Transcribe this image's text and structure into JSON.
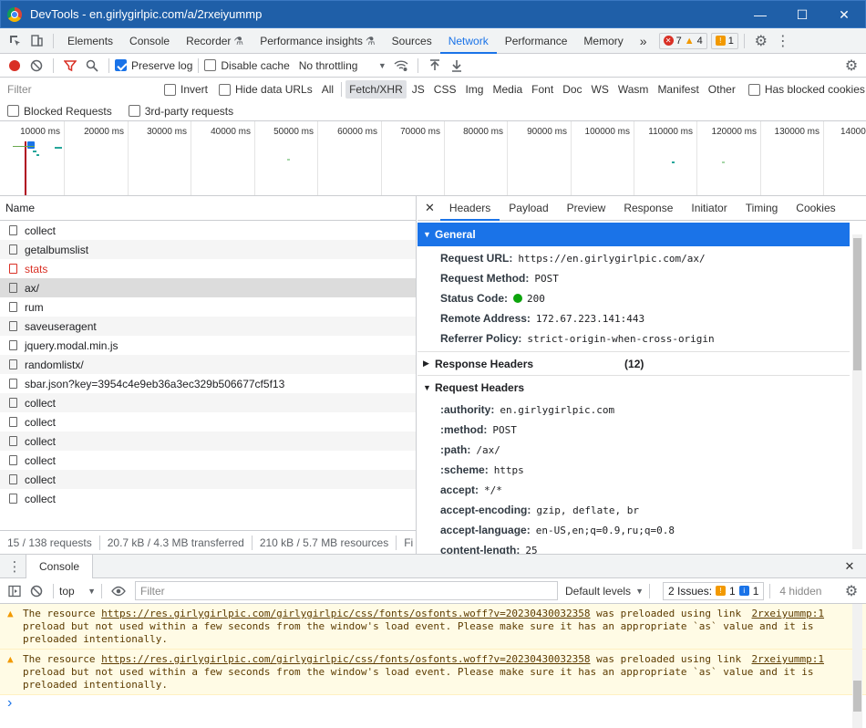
{
  "window": {
    "title": "DevTools - en.girlygirlpic.com/a/2rxeiyummp",
    "minimize": "—",
    "maximize": "☐",
    "close": "✕"
  },
  "main_tabs": {
    "items": [
      "Elements",
      "Console",
      "Recorder",
      "Performance insights",
      "Sources",
      "Network",
      "Performance",
      "Memory"
    ],
    "active": "Network",
    "more": "»",
    "errors": "7",
    "warnings": "4",
    "issues": "1"
  },
  "network_toolbar": {
    "preserve_log": "Preserve log",
    "disable_cache": "Disable cache",
    "throttling": "No throttling"
  },
  "filter": {
    "placeholder": "Filter",
    "invert": "Invert",
    "hide_data_urls": "Hide data URLs",
    "types": [
      "All",
      "Fetch/XHR",
      "JS",
      "CSS",
      "Img",
      "Media",
      "Font",
      "Doc",
      "WS",
      "Wasm",
      "Manifest",
      "Other"
    ],
    "active_type": "Fetch/XHR",
    "has_blocked_cookies": "Has blocked cookies",
    "blocked_requests": "Blocked Requests",
    "third_party": "3rd-party requests"
  },
  "overview": {
    "ticks": [
      "10000 ms",
      "20000 ms",
      "30000 ms",
      "40000 ms",
      "50000 ms",
      "60000 ms",
      "70000 ms",
      "80000 ms",
      "90000 ms",
      "100000 ms",
      "110000 ms",
      "120000 ms",
      "130000 ms",
      "14000"
    ]
  },
  "requests": {
    "column_name": "Name",
    "rows": [
      {
        "name": "collect",
        "status": "ok"
      },
      {
        "name": "getalbumslist",
        "status": "ok"
      },
      {
        "name": "stats",
        "status": "failed"
      },
      {
        "name": "ax/",
        "status": "selected"
      },
      {
        "name": "rum",
        "status": "ok"
      },
      {
        "name": "saveuseragent",
        "status": "ok"
      },
      {
        "name": "jquery.modal.min.js",
        "status": "ok"
      },
      {
        "name": "randomlistx/",
        "status": "ok"
      },
      {
        "name": "sbar.json?key=3954c4e9eb36a3ec329b506677cf5f13",
        "status": "ok"
      },
      {
        "name": "collect",
        "status": "ok"
      },
      {
        "name": "collect",
        "status": "ok"
      },
      {
        "name": "collect",
        "status": "ok"
      },
      {
        "name": "collect",
        "status": "ok"
      },
      {
        "name": "collect",
        "status": "ok"
      },
      {
        "name": "collect",
        "status": "ok"
      }
    ],
    "status": {
      "count": "15 / 138 requests",
      "transferred": "20.7 kB / 4.3 MB transferred",
      "resources": "210 kB / 5.7 MB resources",
      "finish": "Fi"
    }
  },
  "details": {
    "close": "✕",
    "tabs": [
      "Headers",
      "Payload",
      "Preview",
      "Response",
      "Initiator",
      "Timing",
      "Cookies"
    ],
    "active_tab": "Headers",
    "general": {
      "title": "General",
      "rows": [
        {
          "k": "Request URL:",
          "v": "https://en.girlygirlpic.com/ax/"
        },
        {
          "k": "Request Method:",
          "v": "POST"
        },
        {
          "k": "Status Code:",
          "v": "200"
        },
        {
          "k": "Remote Address:",
          "v": "172.67.223.141:443"
        },
        {
          "k": "Referrer Policy:",
          "v": "strict-origin-when-cross-origin"
        }
      ]
    },
    "response_headers": {
      "title": "Response Headers",
      "count": "(12)"
    },
    "request_headers": {
      "title": "Request Headers",
      "rows": [
        {
          "k": ":authority:",
          "v": "en.girlygirlpic.com"
        },
        {
          "k": ":method:",
          "v": "POST"
        },
        {
          "k": ":path:",
          "v": "/ax/"
        },
        {
          "k": ":scheme:",
          "v": "https"
        },
        {
          "k": "accept:",
          "v": "*/*"
        },
        {
          "k": "accept-encoding:",
          "v": "gzip, deflate, br"
        },
        {
          "k": "accept-language:",
          "v": "en-US,en;q=0.9,ru;q=0.8"
        },
        {
          "k": "content-length:",
          "v": "25"
        }
      ]
    }
  },
  "drawer": {
    "tab": "Console",
    "close": "✕"
  },
  "console": {
    "context": "top",
    "filter_placeholder": "Filter",
    "levels": "Default levels",
    "issues_label": "2 Issues:",
    "issues_warn": "1",
    "issues_info": "1",
    "hidden": "4 hidden",
    "messages": [
      {
        "prefix": "The resource ",
        "url": "https://res.girlygirlpic.com/girlygirlpic/css/fonts/osfonts.woff?v=20230430032358",
        "text": " was preloaded using link\npreload but not used within a few seconds from the window's load event. Please make sure it has an appropriate `as` value and it is\npreloaded intentionally.",
        "source": "2rxeiyummp:1"
      },
      {
        "prefix": "The resource ",
        "url": "https://res.girlygirlpic.com/girlygirlpic/css/fonts/osfonts.woff?v=20230430032358",
        "text": " was preloaded using link\npreload but not used within a few seconds from the window's load event. Please make sure it has an appropriate `as` value and it is\npreloaded intentionally.",
        "source": "2rxeiyummp:1"
      }
    ],
    "prompt": "›"
  },
  "colors": {
    "accent": "#1a73e8",
    "titlebar": "#1f5fa8",
    "error": "#d93025",
    "warning": "#f29900",
    "success": "#0ca40c"
  }
}
